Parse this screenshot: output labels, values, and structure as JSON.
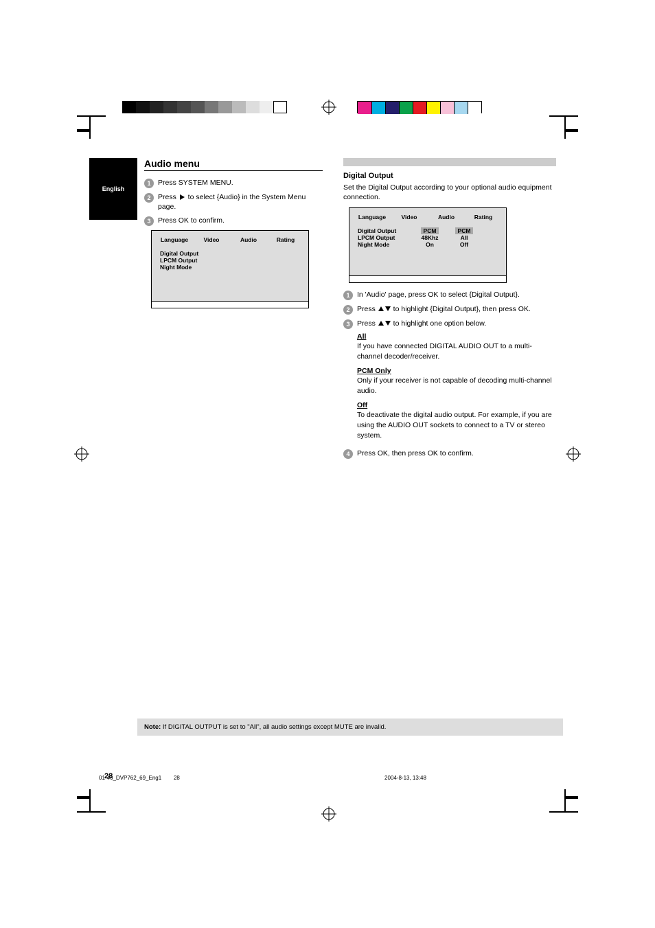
{
  "side_tab": "English",
  "left": {
    "title": "Audio menu",
    "step1": "Press SYSTEM MENU.",
    "step2a": "Press ",
    "step2b": " to select {Audio} in the System Menu page.",
    "step3": "Press OK to confirm."
  },
  "osd": {
    "tab_language": "Language",
    "tab_video": "Video",
    "tab_audio": "Audio",
    "tab_rating": "Rating",
    "row1": "Digital Output",
    "row2": "LPCM Output",
    "row3": "Night Mode",
    "val_pcm": "PCM",
    "val_48": "48Khz",
    "val_on": "On",
    "val_all": "All",
    "val_off": "Off"
  },
  "right": {
    "title": "Digital Output",
    "desc": "Set the Digital Output according to your optional audio equipment connection.",
    "step1": "In 'Audio' page, press OK to select {Digital Output}.",
    "step2a": "Press ",
    "step2b": " to highlight {Digital Output}, then press OK.",
    "step3a": "Press ",
    "step3b": " to highlight one option below.",
    "opt_all_label": "All",
    "opt_all_text": "If you have connected DIGITAL AUDIO OUT to a multi-channel decoder/receiver.",
    "opt_pcm_label": "PCM Only",
    "opt_pcm_text": "Only if your receiver is not capable of decoding multi-channel audio.",
    "opt_off_label": "Off",
    "opt_off_text": "To deactivate the digital audio output. For example, if you are using the AUDIO OUT sockets to connect to a TV or stereo system.",
    "step4": "Press OK, then press OK to confirm."
  },
  "note": {
    "title": "Note:",
    "text": "If DIGITAL OUTPUT is set to \"All\", all audio settings except MUTE are invalid."
  },
  "page_number": "28",
  "footer_left": "01-46_DVP762_69_Eng1",
  "footer_page": "28",
  "footer_right": "2004-8-13, 13:48"
}
